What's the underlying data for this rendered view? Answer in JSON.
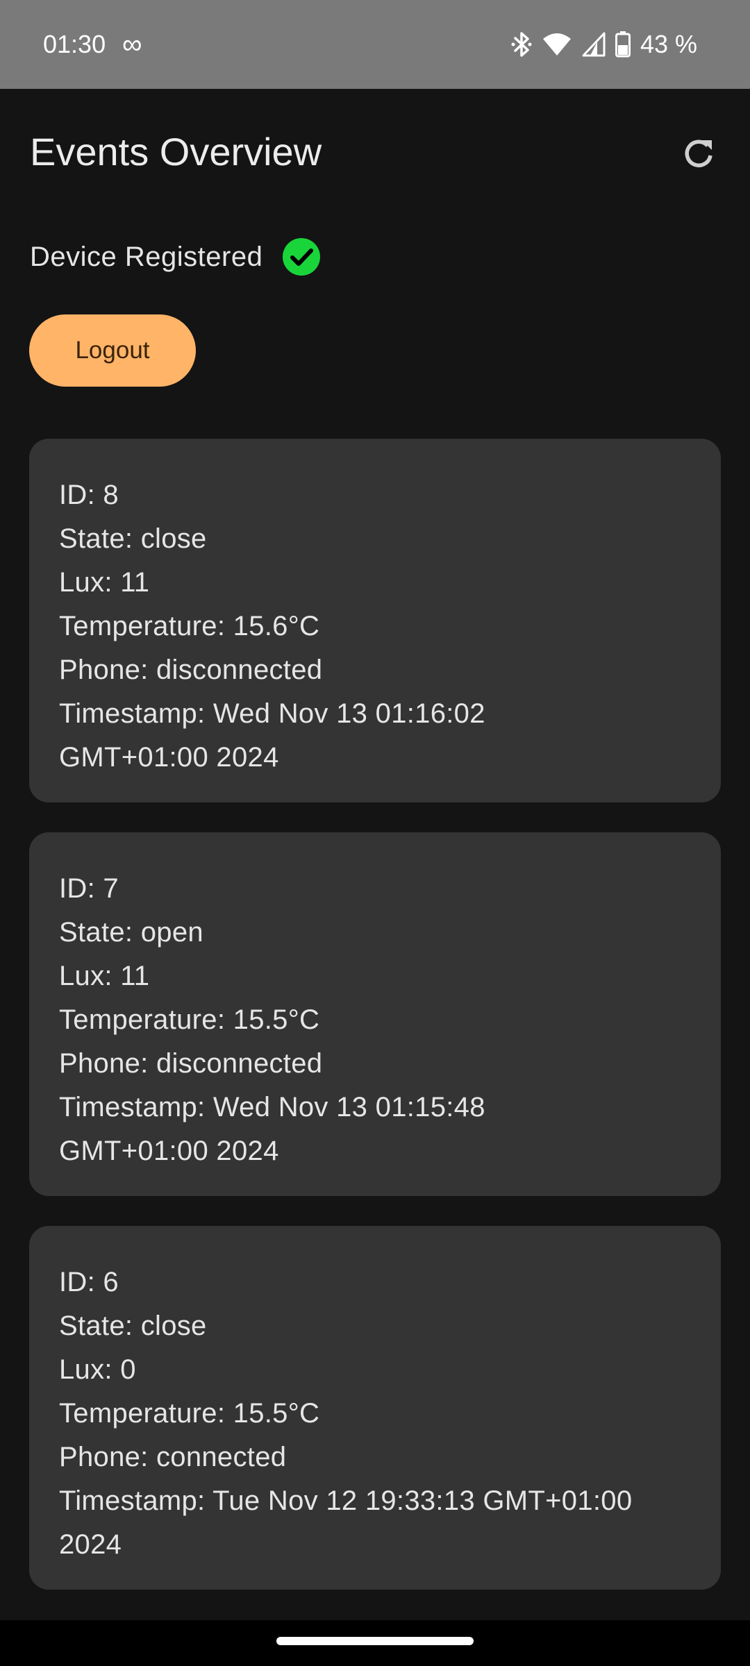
{
  "status_bar": {
    "time": "01:30",
    "extra_icon": "∞",
    "battery_percent": "43 %",
    "icons": [
      "bluetooth-icon",
      "wifi-icon",
      "signal-icon",
      "battery-icon"
    ]
  },
  "header": {
    "title": "Events Overview",
    "refresh_icon": "refresh-icon"
  },
  "device": {
    "label": "Device Registered",
    "status_icon": "check-circle-icon",
    "status_color": "#19d53a"
  },
  "logout": {
    "label": "Logout",
    "color": "#ffb468"
  },
  "events": [
    {
      "id": "ID: 8",
      "state": "State: close",
      "lux": "Lux: 11",
      "temperature": "Temperature: 15.6°C",
      "phone": "Phone: disconnected",
      "timestamp": "Timestamp: Wed Nov 13 01:16:02 GMT+01:00 2024"
    },
    {
      "id": "ID: 7",
      "state": "State: open",
      "lux": "Lux: 11",
      "temperature": "Temperature: 15.5°C",
      "phone": "Phone: disconnected",
      "timestamp": "Timestamp: Wed Nov 13 01:15:48 GMT+01:00 2024"
    },
    {
      "id": "ID: 6",
      "state": "State: close",
      "lux": "Lux: 0",
      "temperature": "Temperature: 15.5°C",
      "phone": "Phone: connected",
      "timestamp": "Timestamp: Tue Nov 12 19:33:13 GMT+01:00 2024"
    }
  ]
}
